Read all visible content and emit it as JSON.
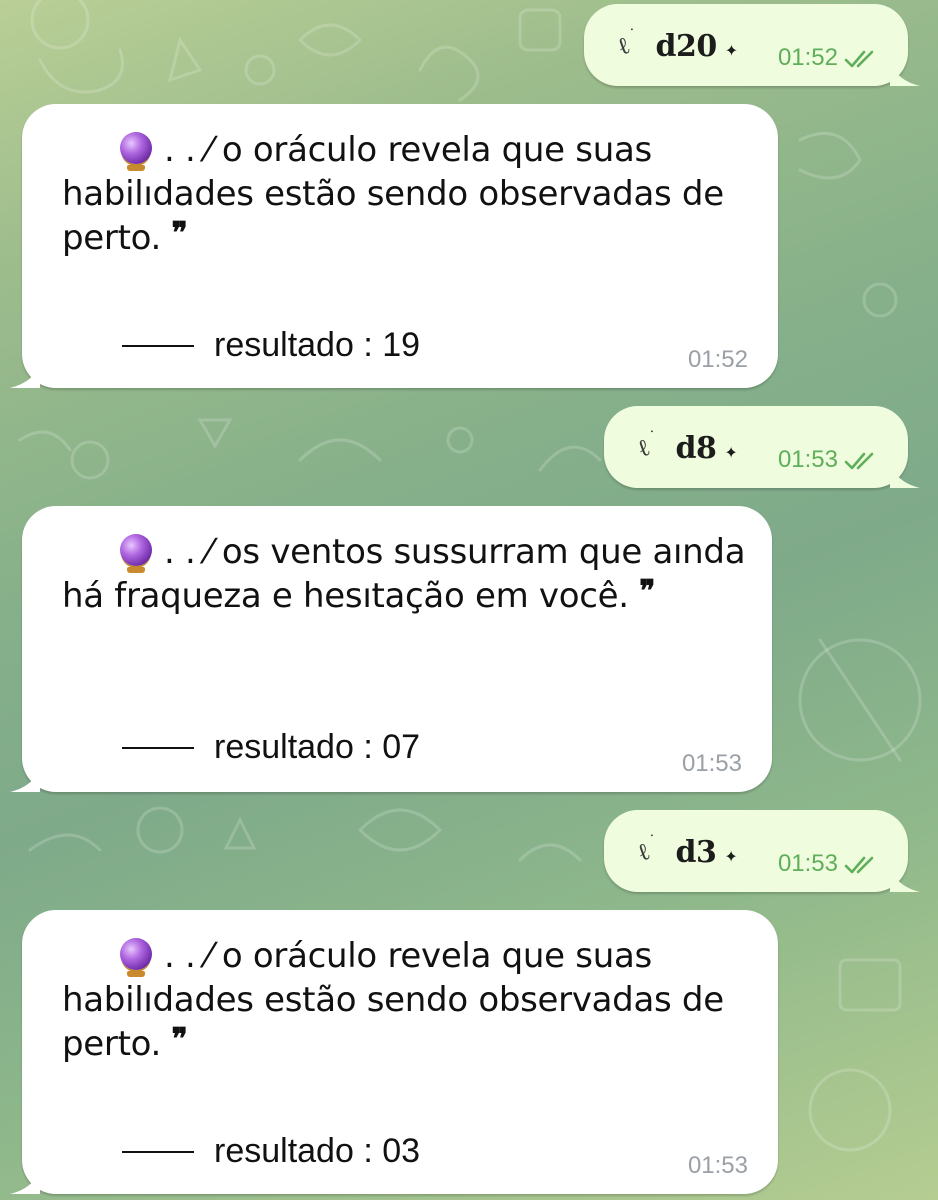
{
  "messages": [
    {
      "type": "outgoing",
      "dice_glyph": "ℓ",
      "command": "d20",
      "spark": "✦",
      "time": "01:52",
      "status": "read"
    },
    {
      "type": "incoming",
      "emoji": "crystal-ball",
      "prefix": ". . ⁄ ",
      "text": "o oráculo revela que suas habilıdades estão sendo observadas de perto.",
      "quote": "❞",
      "result_text": "resultado : 19",
      "time": "01:52"
    },
    {
      "type": "outgoing",
      "dice_glyph": "ℓ",
      "command": "d8",
      "spark": "✦",
      "time": "01:53",
      "status": "read"
    },
    {
      "type": "incoming",
      "emoji": "crystal-ball",
      "prefix": ". . ⁄ ",
      "text": "os ventos sussurram que aında há fraqueza e hesıtação em você.",
      "quote": "❞",
      "result_text": "resultado : 07",
      "time": "01:53"
    },
    {
      "type": "outgoing",
      "dice_glyph": "ℓ",
      "command": "d3",
      "spark": "✦",
      "time": "01:53",
      "status": "read"
    },
    {
      "type": "incoming",
      "emoji": "crystal-ball",
      "prefix": ". . ⁄ ",
      "text": "o oráculo revela que suas habilıdades estão sendo observadas de perto.",
      "quote": "❞",
      "result_text": "resultado : 03",
      "time": "01:53"
    }
  ],
  "colors": {
    "outgoing_bubble": "#effdde",
    "incoming_bubble": "#ffffff",
    "outgoing_time": "#5fae5a",
    "incoming_time": "#9aa0a6"
  }
}
